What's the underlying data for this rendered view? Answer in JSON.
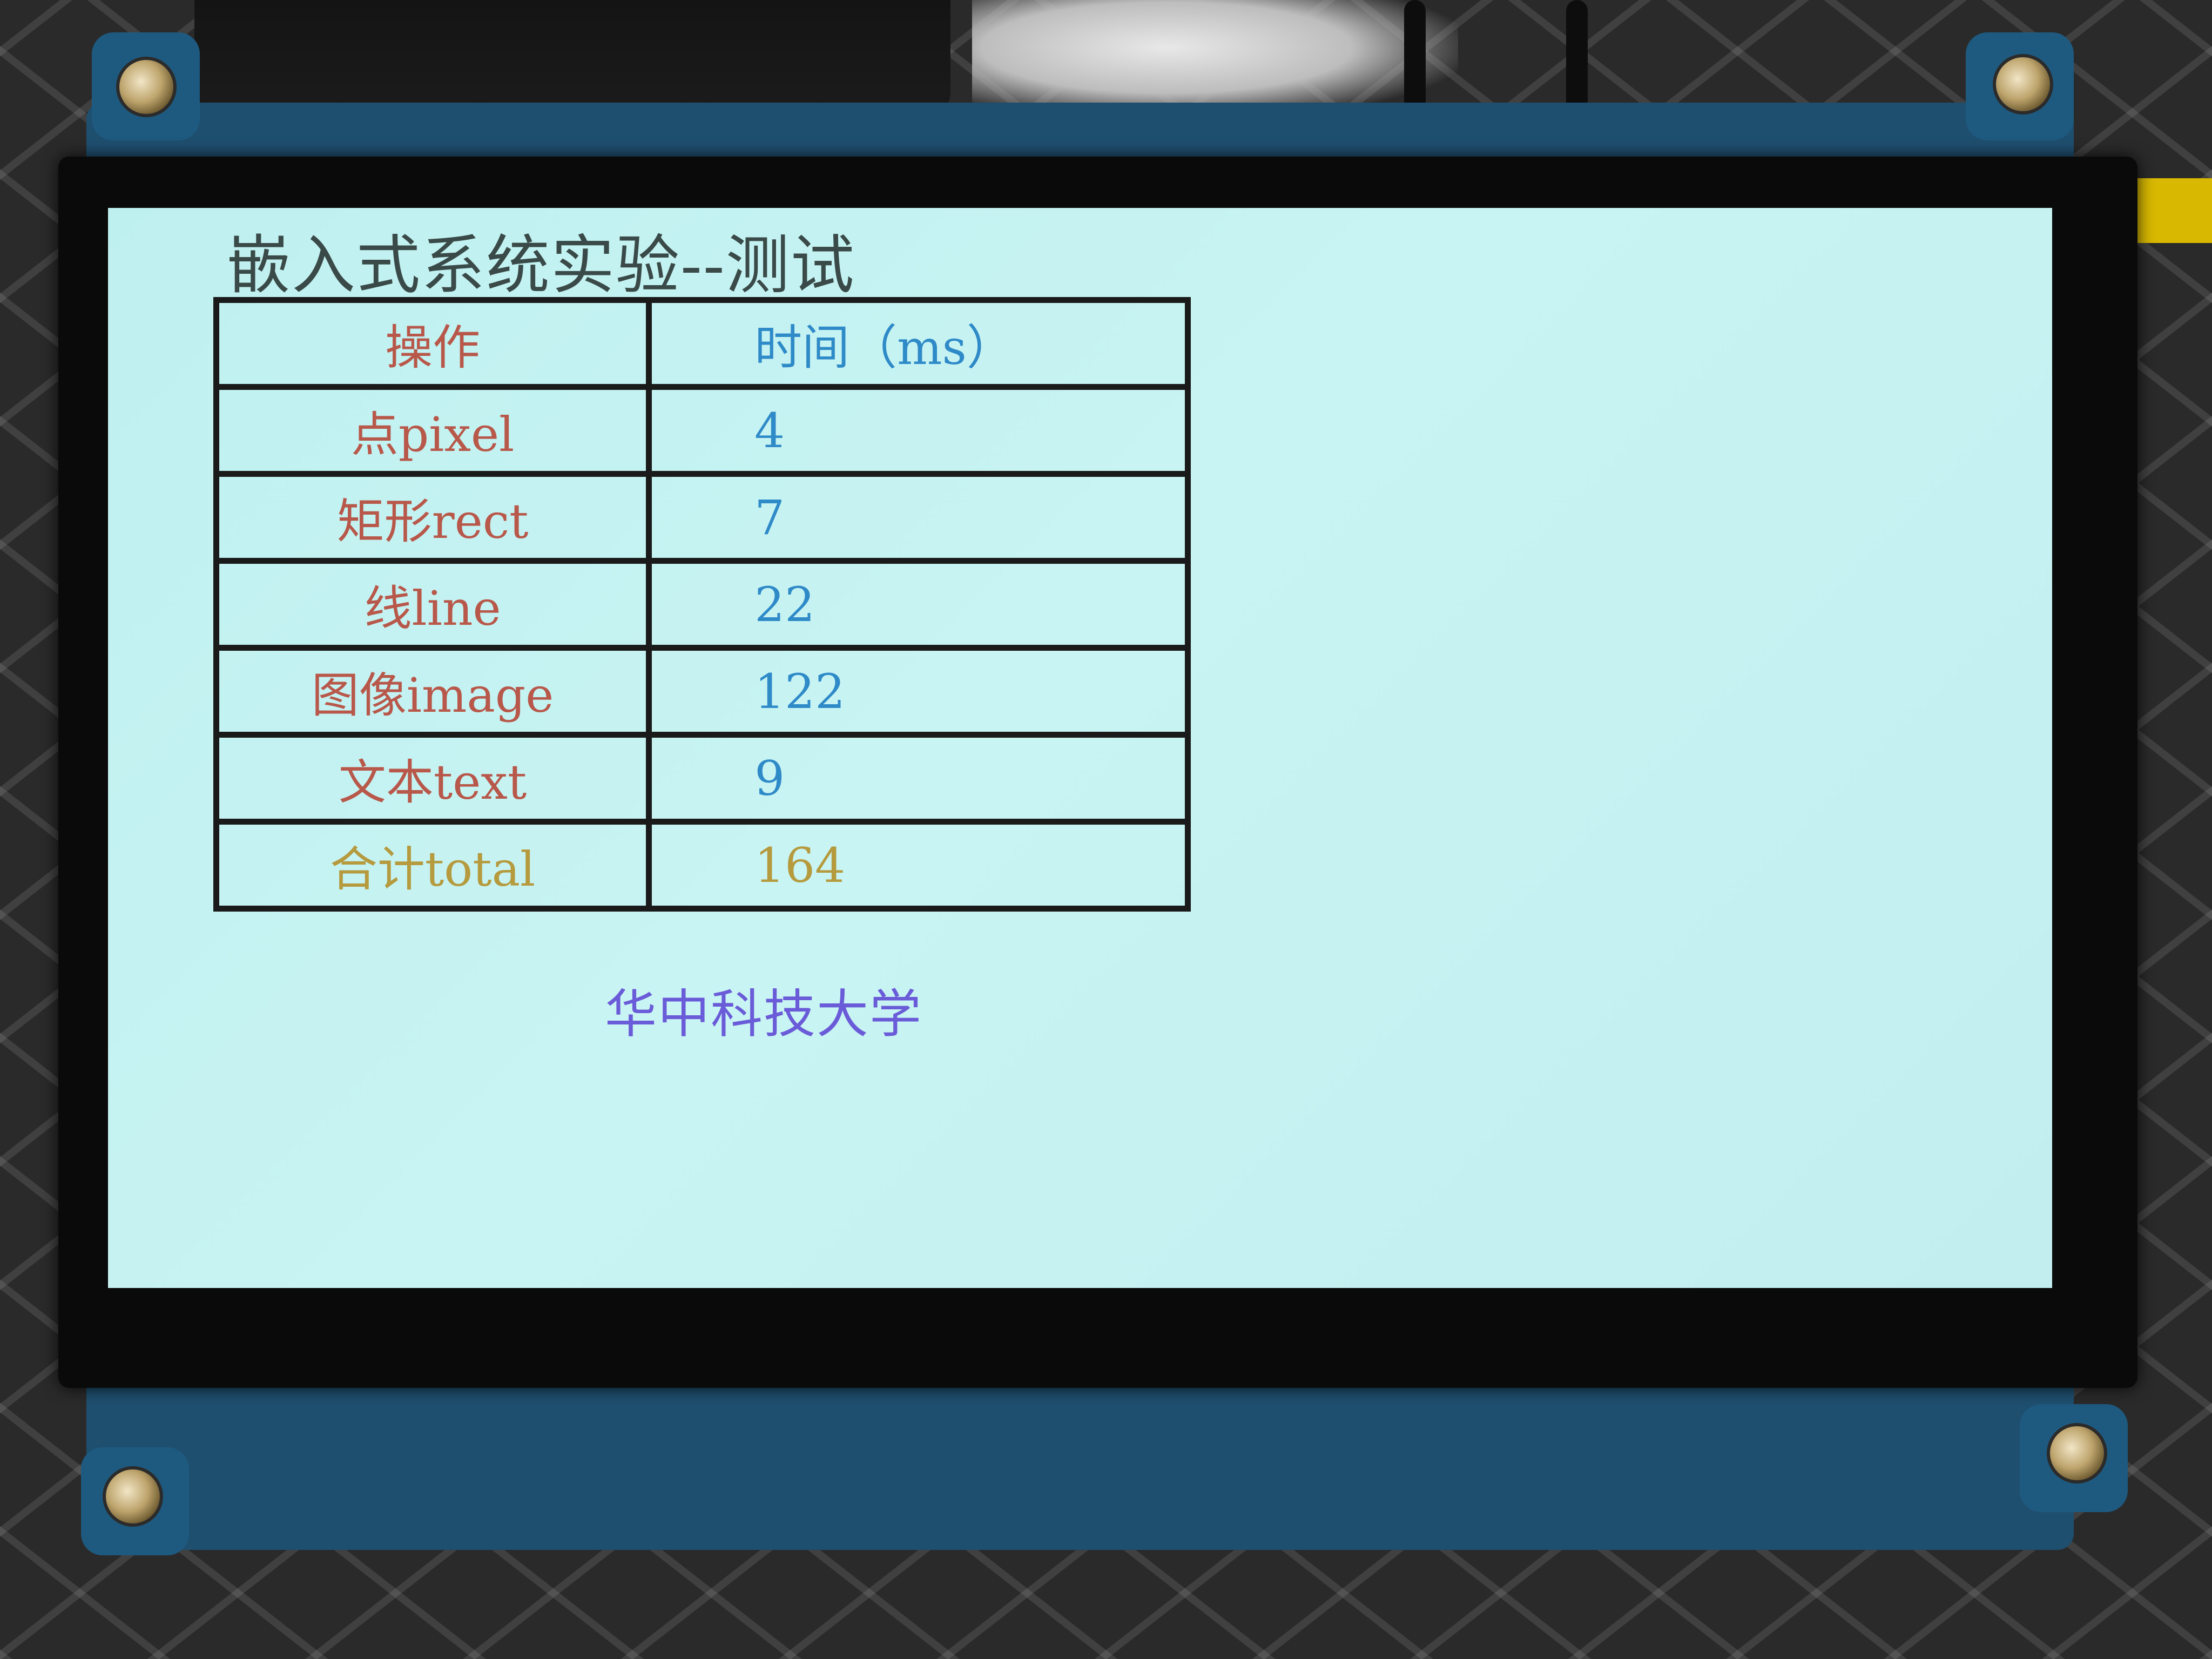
{
  "screen": {
    "title": "嵌入式系统实验--测试",
    "table": {
      "header": {
        "operation": "操作",
        "time": "时间（ms）"
      },
      "rows": [
        {
          "operation": "点pixel",
          "time": "4"
        },
        {
          "operation": "矩形rect",
          "time": "7"
        },
        {
          "operation": "线line",
          "time": "22"
        },
        {
          "operation": "图像image",
          "time": "122"
        },
        {
          "operation": "文本text",
          "time": "9"
        }
      ],
      "total": {
        "operation": "合计total",
        "time": "164"
      }
    },
    "footer": "华中科技大学"
  },
  "colors": {
    "screen_background": "#c2eef0",
    "operation_text": "#b8584a",
    "time_text": "#2f8ac8",
    "total_text": "#b59a3e",
    "footer_text": "#6a5bd8",
    "title_text": "#3a4a48",
    "table_border": "#1a1a1a"
  }
}
